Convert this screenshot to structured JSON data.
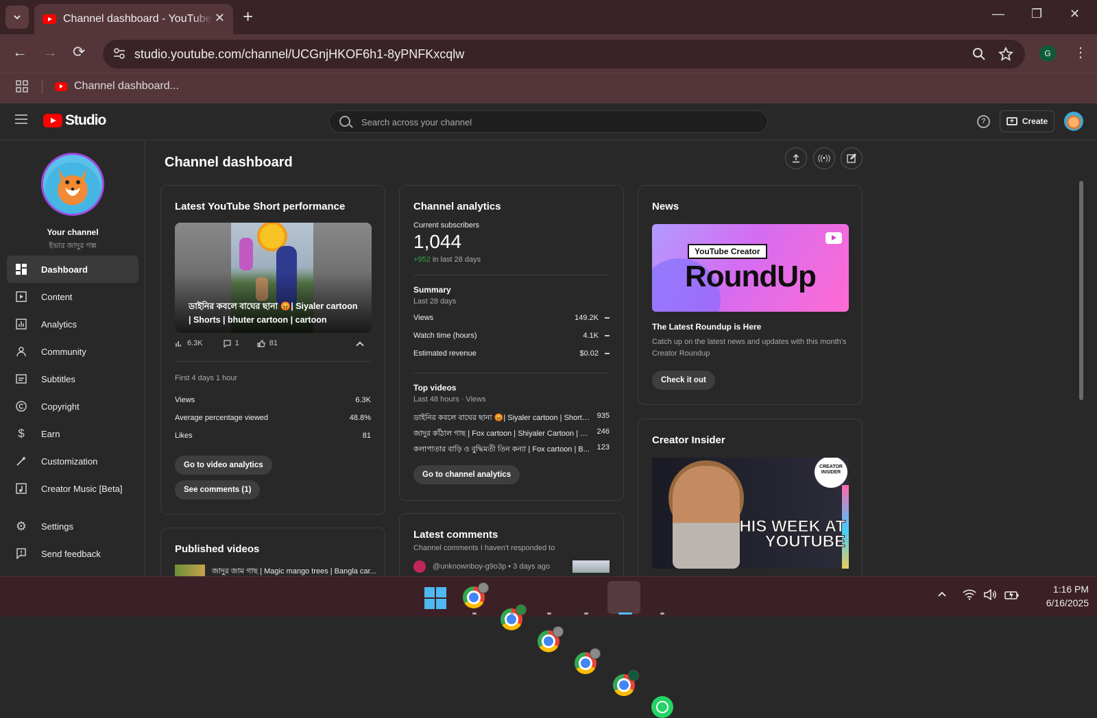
{
  "browser": {
    "tab_title": "Channel dashboard - YouTube Studio",
    "url": "studio.youtube.com/channel/UCGnjHKOF6h1-8yPNFKxcqlw",
    "bookmark": "Channel dashboard...",
    "profile_initial": "G"
  },
  "studio": {
    "logo_text": "Studio",
    "search_placeholder": "Search across your channel",
    "create_label": "Create"
  },
  "sidebar": {
    "channel_label": "Your channel",
    "channel_name": "ইভার জাদুর গল্প",
    "items": [
      {
        "label": "Dashboard",
        "icon": "dashboard-icon"
      },
      {
        "label": "Content",
        "icon": "content-icon"
      },
      {
        "label": "Analytics",
        "icon": "analytics-icon"
      },
      {
        "label": "Community",
        "icon": "community-icon"
      },
      {
        "label": "Subtitles",
        "icon": "subtitles-icon"
      },
      {
        "label": "Copyright",
        "icon": "copyright-icon"
      },
      {
        "label": "Earn",
        "icon": "earn-icon"
      },
      {
        "label": "Customization",
        "icon": "customization-icon"
      },
      {
        "label": "Creator Music [Beta]",
        "icon": "creator-music-icon"
      },
      {
        "label": "Settings",
        "icon": "settings-icon"
      },
      {
        "label": "Send feedback",
        "icon": "feedback-icon"
      }
    ]
  },
  "main": {
    "page_title": "Channel dashboard"
  },
  "short_card": {
    "title": "Latest YouTube Short performance",
    "video_title": "ডাইনির কবলে বাঘের ছানা 😡| Siyaler cartoon | Shorts | bhuter cartoon | cartoon",
    "views_count": "6.3K",
    "comments_count": "1",
    "likes_count": "81",
    "period": "First 4 days 1 hour",
    "rows": [
      {
        "label": "Views",
        "value": "6.3K"
      },
      {
        "label": "Average percentage viewed",
        "value": "48.8%"
      },
      {
        "label": "Likes",
        "value": "81"
      }
    ],
    "btn_analytics": "Go to video analytics",
    "btn_comments": "See comments (1)"
  },
  "published_card": {
    "title": "Published videos",
    "first_item": "জাদুর জাম গাছ | Magic mango trees | Bangla car..."
  },
  "analytics_card": {
    "title": "Channel analytics",
    "subs_label": "Current subscribers",
    "subs_value": "1,044",
    "subs_delta": "+952",
    "subs_delta_suffix": " in last 28 days",
    "summary_title": "Summary",
    "summary_period": "Last 28 days",
    "summary_rows": [
      {
        "label": "Views",
        "value": "149.2K"
      },
      {
        "label": "Watch time (hours)",
        "value": "4.1K"
      },
      {
        "label": "Estimated revenue",
        "value": "$0.02"
      }
    ],
    "top_title": "Top videos",
    "top_period": "Last 48 hours · Views",
    "top_videos": [
      {
        "title": "ডাইনির কবলে বাঘের ছানা 😡| Siyaler cartoon | Shorts...",
        "views": "935"
      },
      {
        "title": "জাদুর কাঁঠাল গাছ | Fox cartoon | Shiyaler Cartoon | Ba...",
        "views": "246"
      },
      {
        "title": "কলাপাতার বাড়ি ও বুদ্ধিমতী তিন কন্যা | Fox cartoon | B...",
        "views": "123"
      }
    ],
    "btn": "Go to channel analytics"
  },
  "comments_card": {
    "title": "Latest comments",
    "subtitle": "Channel comments I haven't responded to",
    "first_comment_meta": "@unknownboy-g9o3p • 3 days ago"
  },
  "news_card": {
    "title": "News",
    "img_tag": "YouTube Creator",
    "img_big": "RoundUp",
    "headline": "The Latest Roundup is Here",
    "body": "Catch up on the latest news and updates with this month's Creator Roundup",
    "btn": "Check it out"
  },
  "insider_card": {
    "title": "Creator Insider",
    "badge": "CREATOR INSIDER",
    "overlay": "THIS WEEK AT YOUTUBE"
  },
  "taskbar": {
    "time": "1:16 PM",
    "date": "6/16/2025"
  },
  "colors": {
    "accent_red": "#ff0000",
    "positive_green": "#2ba640",
    "browser_chrome": "#54363a"
  }
}
